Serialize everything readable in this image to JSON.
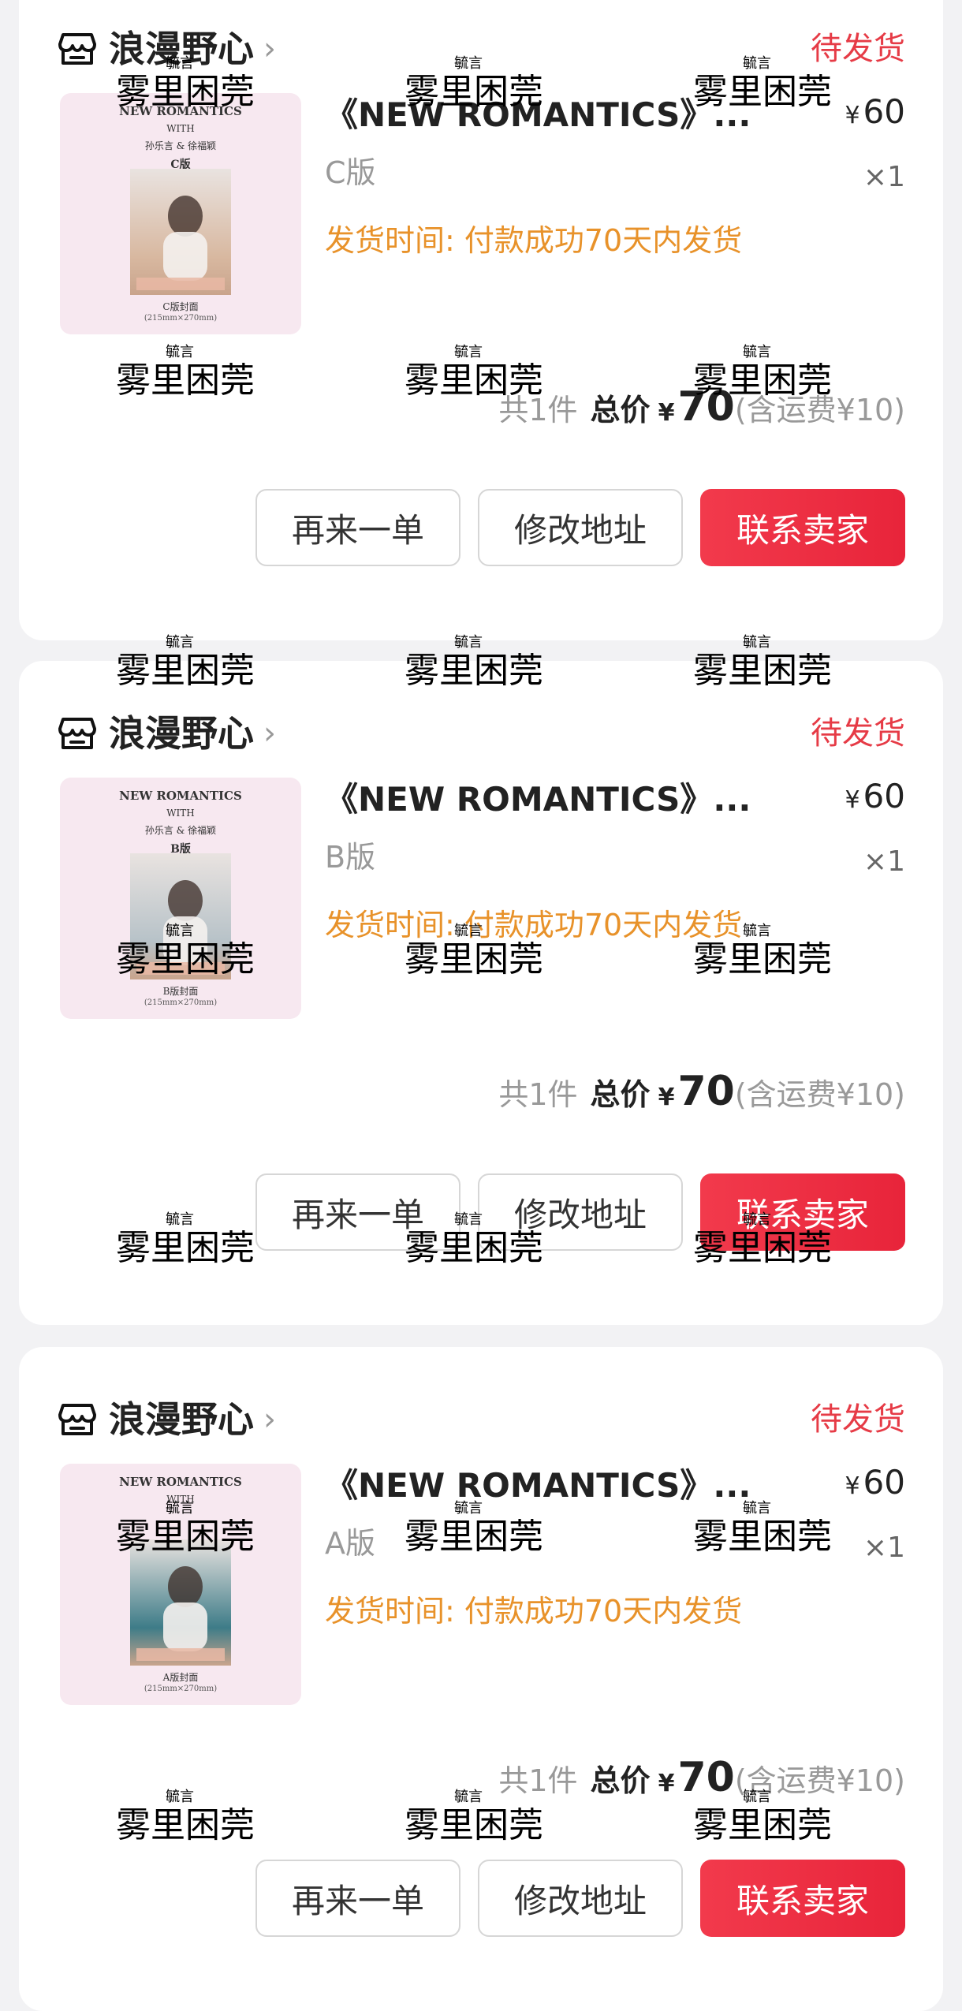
{
  "orders": [
    {
      "store": "浪漫野心",
      "status": "待发货",
      "title": "《NEW ROMANTICS》...",
      "price": "60",
      "variant": "C版",
      "qty": "×1",
      "ship_time": "发货时间: 付款成功70天内发货",
      "count": "共1件",
      "total_label": "总价",
      "total_amount": "70",
      "ship_fee": "(含运费¥10)",
      "cover": {
        "line1": "NEW ROMANTICS",
        "line2": "WITH",
        "line3": "孙乐言 & 徐福颖",
        "line4": "C版",
        "line5": "C版封面",
        "line6": "(215mm×270mm)",
        "tint": "#d8b8a0"
      },
      "buttons": {
        "reorder": "再来一单",
        "edit_address": "修改地址",
        "contact_seller": "联系卖家"
      }
    },
    {
      "store": "浪漫野心",
      "status": "待发货",
      "title": "《NEW ROMANTICS》...",
      "price": "60",
      "variant": "B版",
      "qty": "×1",
      "ship_time": "发货时间: 付款成功70天内发货",
      "count": "共1件",
      "total_label": "总价",
      "total_amount": "70",
      "ship_fee": "(含运费¥10)",
      "cover": {
        "line1": "NEW ROMANTICS",
        "line2": "WITH",
        "line3": "孙乐言 & 徐福颖",
        "line4": "B版",
        "line5": "B版封面",
        "line6": "(215mm×270mm)",
        "tint": "#b7c2c8"
      },
      "buttons": {
        "reorder": "再来一单",
        "edit_address": "修改地址",
        "contact_seller": "联系卖家"
      }
    },
    {
      "store": "浪漫野心",
      "status": "待发货",
      "title": "《NEW ROMANTICS》...",
      "price": "60",
      "variant": "A版",
      "qty": "×1",
      "ship_time": "发货时间: 付款成功70天内发货",
      "count": "共1件",
      "total_label": "总价",
      "total_amount": "70",
      "ship_fee": "(含运费¥10)",
      "cover": {
        "line1": "NEW ROMANTICS",
        "line2": "WITH",
        "line3": "",
        "line4": "",
        "line5": "A版封面",
        "line6": "(215mm×270mm)",
        "tint": "#3e7c88"
      },
      "buttons": {
        "reorder": "再来一单",
        "edit_address": "修改地址",
        "contact_seller": "联系卖家"
      }
    }
  ],
  "currency_symbol": "¥",
  "watermark": {
    "small": "毓言",
    "big": "雾里困莞"
  },
  "colors": {
    "accent_red": "#e63b46",
    "ship_orange": "#e8922a",
    "background": "#f2f2f4"
  },
  "icons": {
    "store": "store-icon",
    "chevron": "chevron-right-icon"
  }
}
